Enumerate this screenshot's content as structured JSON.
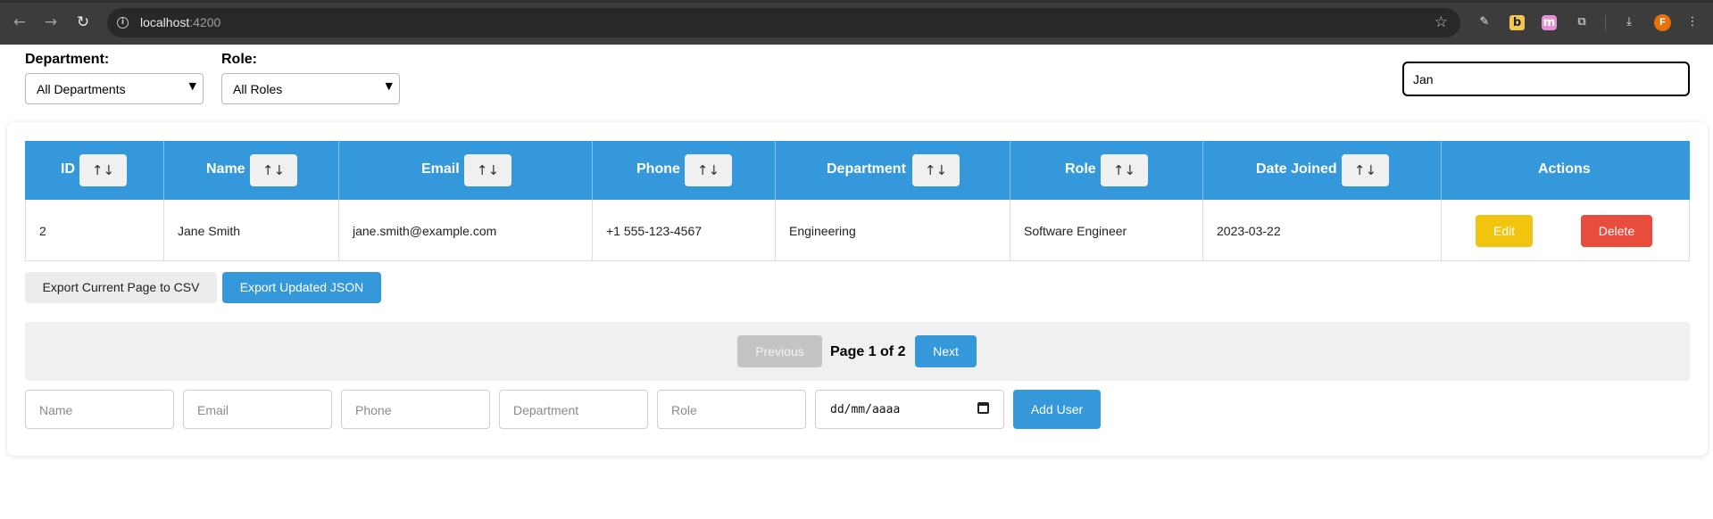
{
  "browser": {
    "url_host": "localhost",
    "url_port": ":4200",
    "avatar_letter": "F",
    "ext_b_letter": "b",
    "ext_m_letter": "m"
  },
  "filters": {
    "department_label": "Department:",
    "department_value": "All Departments",
    "role_label": "Role:",
    "role_value": "All Roles",
    "search_value": "Jan"
  },
  "table": {
    "headers": [
      "ID",
      "Name",
      "Email",
      "Phone",
      "Department",
      "Role",
      "Date Joined",
      "Actions"
    ],
    "sort_glyph": "↑↓",
    "rows": [
      {
        "id": "2",
        "name": "Jane Smith",
        "email": "jane.smith@example.com",
        "phone": "+1 555-123-4567",
        "department": "Engineering",
        "role": "Software Engineer",
        "date_joined": "2023-03-22",
        "edit_label": "Edit",
        "delete_label": "Delete"
      }
    ]
  },
  "export": {
    "csv_label": "Export Current Page to CSV",
    "json_label": "Export Updated JSON"
  },
  "pagination": {
    "previous_label": "Previous",
    "page_text": "Page 1 of 2",
    "next_label": "Next",
    "current_page": 1,
    "total_pages": 2
  },
  "add_form": {
    "name_placeholder": "Name",
    "email_placeholder": "Email",
    "phone_placeholder": "Phone",
    "department_placeholder": "Department",
    "role_placeholder": "Role",
    "date_placeholder": "dd/mm/aaaa",
    "add_label": "Add User"
  },
  "colors": {
    "primary": "#3498db",
    "edit": "#f1c40f",
    "delete": "#e74c3c"
  }
}
